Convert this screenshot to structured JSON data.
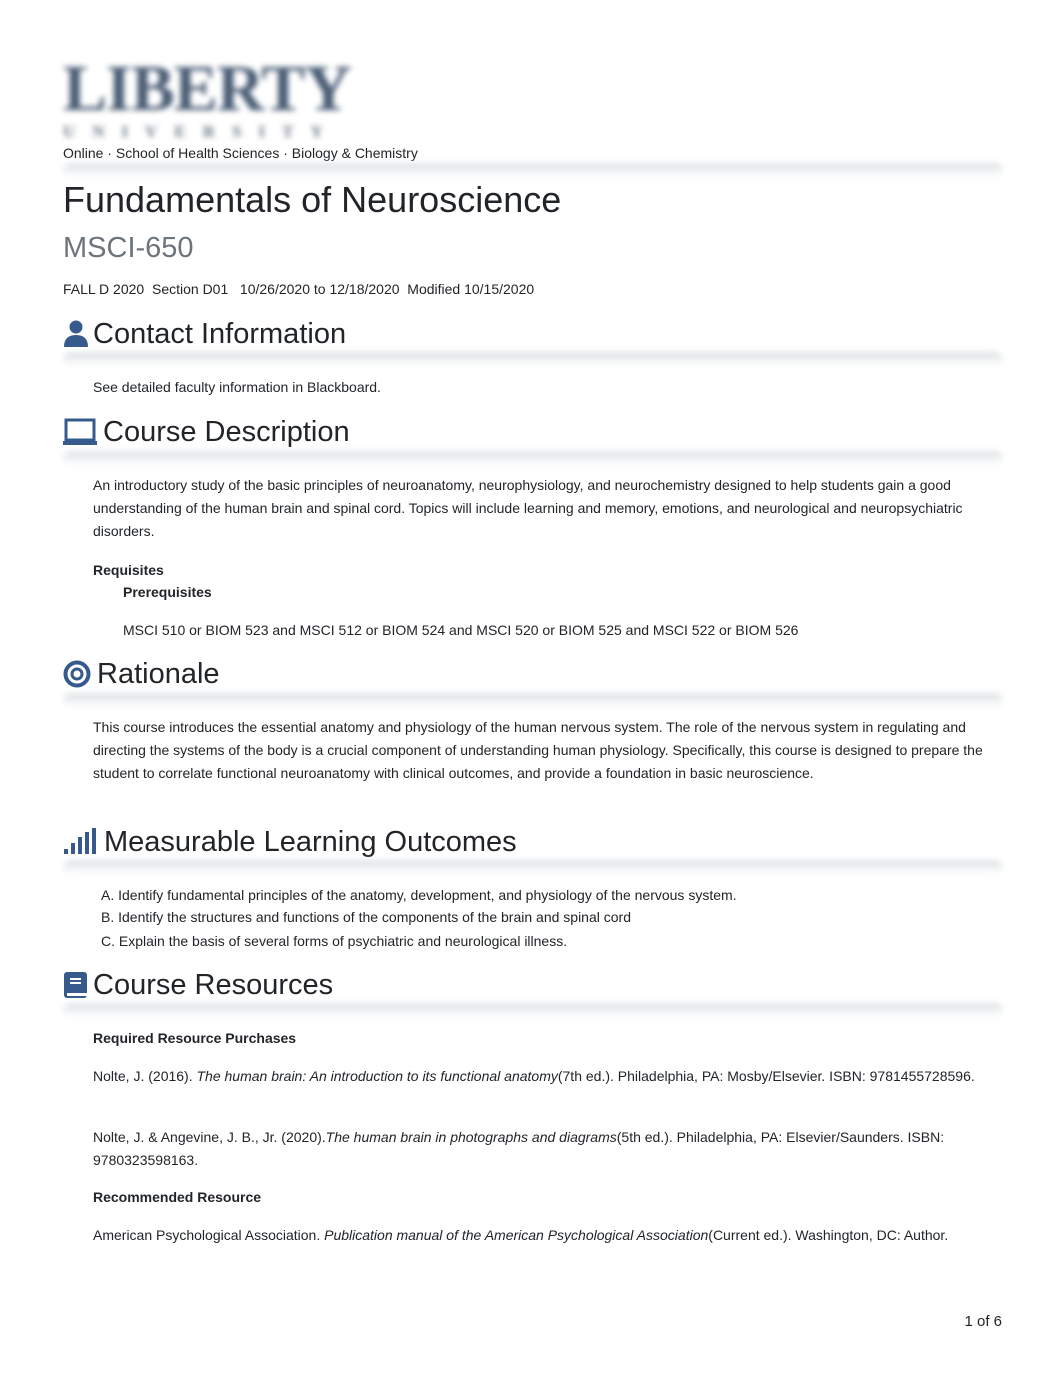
{
  "logo": {
    "word": "LIBERTY",
    "sub": "UNIVERSITY"
  },
  "breadcrumb": "Online · School of Health Sciences · Biology & Chemistry",
  "course": {
    "title": "Fundamentals of Neuroscience",
    "code": "MSCI-650",
    "meta": "FALL D 2020  Section D01   10/26/2020 to 12/18/2020  Modified 10/15/2020"
  },
  "colors": {
    "icon": "#375a8c",
    "text": "#212529",
    "muted": "#6c757d"
  },
  "sections": {
    "contact": {
      "icon": "user-icon",
      "heading": "Contact Information",
      "text": "See detailed faculty information in Blackboard."
    },
    "description": {
      "icon": "laptop-icon",
      "heading": "Course Description",
      "text": "An introductory study of the basic principles of neuroanatomy, neurophysiology, and neurochemistry designed to help students gain a good understanding of the human brain and spinal cord. Topics will include learning and memory, emotions, and neurological and neuropsychiatric disorders.",
      "requisites_label": "Requisites",
      "prerequisites_label": "Prerequisites",
      "prerequisites": "MSCI 510 or BIOM 523 and MSCI 512 or BIOM 524 and MSCI 520 or BIOM 525 and MSCI 522 or BIOM 526"
    },
    "rationale": {
      "icon": "bullseye-icon",
      "heading": "Rationale",
      "text": "This course introduces the essential anatomy and physiology of the human nervous system. The role of the nervous system in regulating and directing the systems of the body is a crucial component of understanding human physiology. Specifically, this course is designed to prepare the student to correlate functional neuroanatomy with clinical outcomes, and provide a foundation in basic neuroscience."
    },
    "outcomes": {
      "icon": "signal-bars-icon",
      "heading": "Measurable Learning Outcomes",
      "items": [
        "A. Identify fundamental principles of the anatomy, development, and physiology of the nervous system.",
        "B. Identify the structures and functions of the components of the brain and spinal cord",
        "C. Explain the basis of several forms of psychiatric and neurological illness."
      ]
    },
    "resources": {
      "icon": "book-icon",
      "heading": "Course Resources",
      "required_label": "Required Resource Purchases",
      "required": [
        {
          "pre": "Nolte, J. (2016). ",
          "title": "The human brain: An introduction to its functional anatomy",
          "post": "(7th ed.). Philadelphia, PA: Mosby/Elsevier. ISBN: 9781455728596."
        },
        {
          "pre": "Nolte, J. & Angevine, J. B., Jr. (2020).",
          "title": "The human brain in photographs and diagrams",
          "post": "(5th ed.). Philadelphia, PA: Elsevier/Saunders. ISBN: 9780323598163."
        }
      ],
      "recommended_label": "Recommended Resource",
      "recommended": [
        {
          "pre": "American Psychological Association. ",
          "title": "Publication manual of the American Psychological Association",
          "post": "(Current ed.). Washington, DC: Author."
        }
      ]
    }
  },
  "footer": {
    "page_indicator": "1 of 6"
  }
}
